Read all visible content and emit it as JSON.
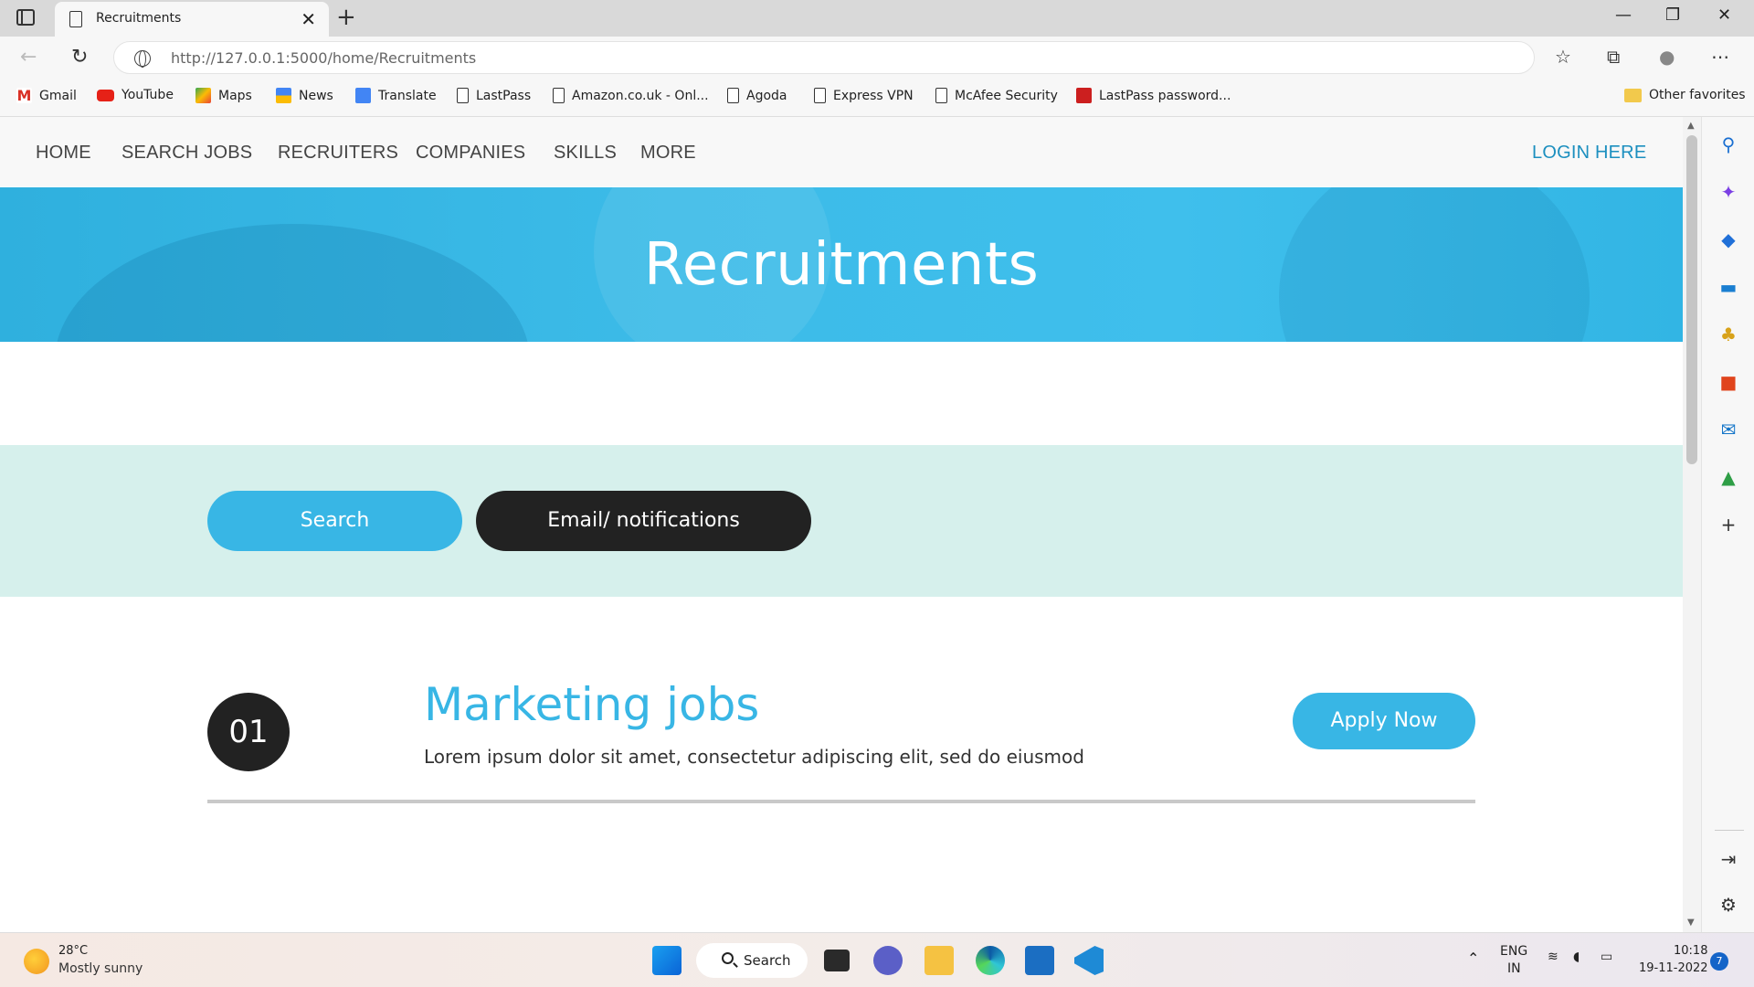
{
  "browser": {
    "tab_title": "Recruitments",
    "tab_close": "✕",
    "new_tab": "+",
    "url": "http://127.0.0.1:5000/home/Recruitments",
    "window_controls": {
      "minimize": "—",
      "restore": "❐",
      "close": "✕"
    }
  },
  "favorites": [
    {
      "label": "Gmail",
      "icon": "gmail-icon",
      "color": "#d93025"
    },
    {
      "label": "YouTube",
      "icon": "youtube-icon",
      "color": "#e62117"
    },
    {
      "label": "Maps",
      "icon": "maps-icon",
      "color": "#34a853"
    },
    {
      "label": "News",
      "icon": "news-icon",
      "color": "#4285f4"
    },
    {
      "label": "Translate",
      "icon": "translate-icon",
      "color": "#4285f4"
    },
    {
      "label": "LastPass",
      "icon": "page-icon",
      "color": "#333333"
    },
    {
      "label": "Amazon.co.uk - Onl...",
      "icon": "page-icon",
      "color": "#333333"
    },
    {
      "label": "Agoda",
      "icon": "page-icon",
      "color": "#333333"
    },
    {
      "label": "Express VPN",
      "icon": "page-icon",
      "color": "#333333"
    },
    {
      "label": "McAfee Security",
      "icon": "page-icon",
      "color": "#333333"
    },
    {
      "label": "LastPass password...",
      "icon": "lastpass-icon",
      "color": "#cc1f1f"
    }
  ],
  "other_favorites": "Other favorites",
  "site_nav": {
    "items": [
      "HOME",
      "SEARCH JOBS",
      "RECRUITERS",
      "COMPANIES",
      "SKILLS",
      "MORE"
    ],
    "login": "LOGIN HERE"
  },
  "banner": {
    "title": "Recruitments"
  },
  "actions": {
    "search": "Search",
    "email": "Email/ notifications"
  },
  "jobs": [
    {
      "number": "01",
      "title": "Marketing jobs",
      "description": "Lorem ipsum dolor sit amet, consectetur adipiscing elit, sed do eiusmod",
      "apply_label": "Apply Now"
    }
  ],
  "taskbar": {
    "weather_temp": "28°C",
    "weather_desc": "Mostly sunny",
    "search_label": "Search",
    "lang_top": "ENG",
    "lang_bottom": "IN",
    "time": "10:18",
    "date": "19-11-2022",
    "notification_count": "7"
  },
  "colors": {
    "accent": "#38b6e5",
    "dark_button": "#222222",
    "band": "#d6f0ec",
    "login_link": "#1c8fbf"
  }
}
